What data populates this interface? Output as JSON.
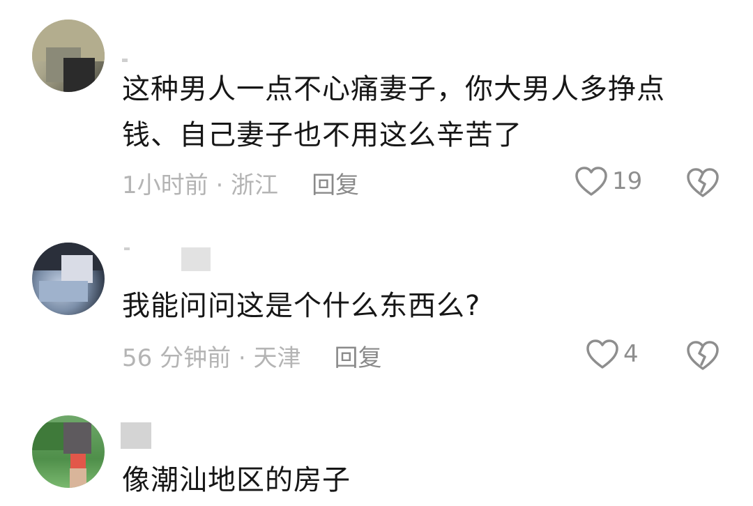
{
  "comments": [
    {
      "text": "这种男人一点不心痛妻子，你大男人多挣点钱、自己妻子也不用这么辛苦了",
      "time_location": "1小时前 · 浙江",
      "reply_label": "回复",
      "likes": "19",
      "like_icon": "heart-outline-icon",
      "dislike_icon": "broken-heart-icon"
    },
    {
      "text": "我能问问这是个什么东西么?",
      "time_location": "56 分钟前 · 天津",
      "reply_label": "回复",
      "likes": "4",
      "like_icon": "heart-outline-icon",
      "dislike_icon": "broken-heart-icon"
    },
    {
      "text": "像潮汕地区的房子"
    }
  ],
  "colors": {
    "text": "#161616",
    "meta": "#b4b4b4",
    "reply": "#8a8a8a",
    "icon": "#8e8e8e",
    "background": "#ffffff"
  }
}
